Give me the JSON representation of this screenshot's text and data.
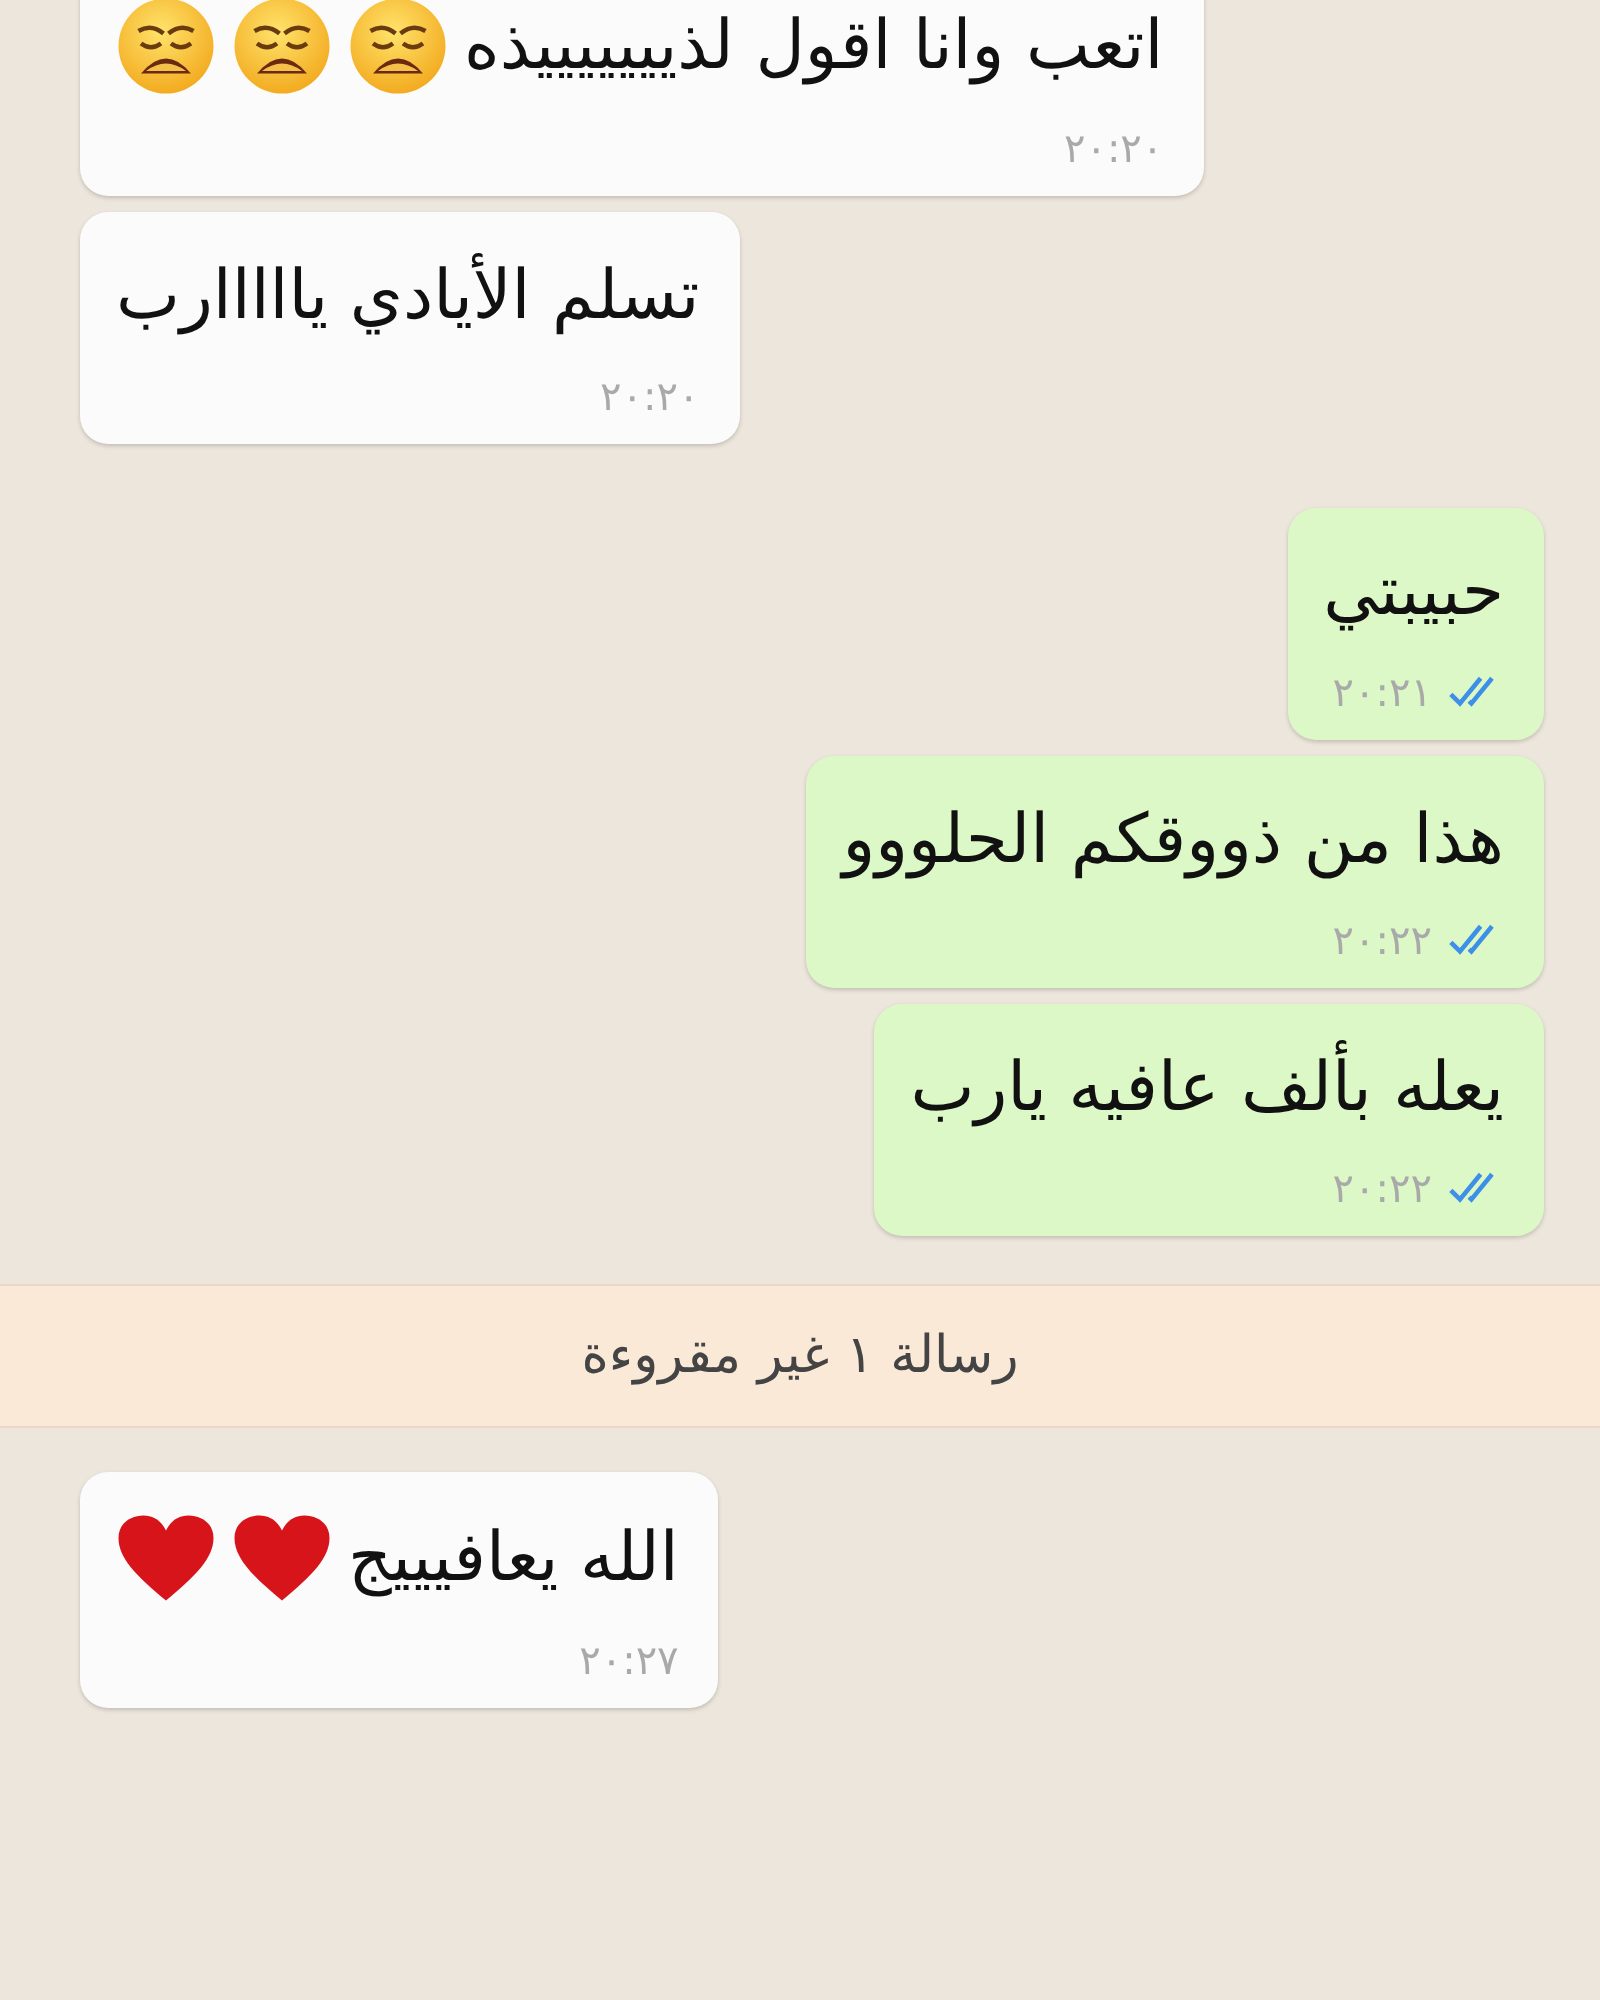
{
  "chat": [
    {
      "kind": "message",
      "outgoing": false,
      "text": "اتعب وانا اقول لذيييييييذه",
      "emoji": [
        {
          "kind": "weary"
        },
        {
          "kind": "weary"
        },
        {
          "kind": "weary"
        }
      ],
      "time": "٢٠:٢٠"
    },
    {
      "kind": "message",
      "outgoing": false,
      "text": "تسلم الأيادي يااااارب",
      "time": "٢٠:٢٠"
    },
    {
      "kind": "message",
      "outgoing": true,
      "text": "حبيبتي",
      "time": "٢٠:٢١",
      "read": true
    },
    {
      "kind": "message",
      "outgoing": true,
      "text": "هذا من ذووقكم الحلووو",
      "time": "٢٠:٢٢",
      "read": true
    },
    {
      "kind": "message",
      "outgoing": true,
      "text": "يعله بألف عافيه يارب",
      "time": "٢٠:٢٢",
      "read": true
    },
    {
      "kind": "banner",
      "text": "رسالة ١ غير مقروءة"
    },
    {
      "kind": "message",
      "outgoing": false,
      "text": "الله يعافيييج",
      "emoji": [
        {
          "kind": "heart"
        },
        {
          "kind": "heart"
        }
      ],
      "time": "٢٠:٢٧"
    }
  ]
}
